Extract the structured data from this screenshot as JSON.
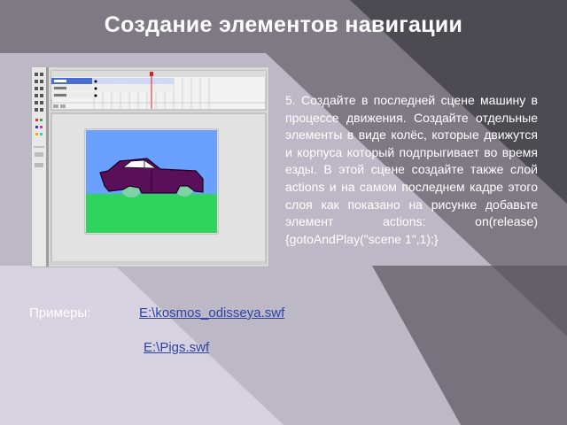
{
  "slide": {
    "title": "Создание элементов навигации",
    "body_text": "5. Создайте в последней сцене машину в процессе движения. Создайте отдельные элементы в виде колёс, которые движутся и корпуса который подпрыгивает во время езды. В этой сцене создайте также слой actions и на самом последнем кадре этого слоя как показано на  рисунке добавьте элемент actions: on(release){gotoAndPlay(\"scene 1\",1);}",
    "examples_label": "Примеры:",
    "links": [
      "E:\\kosmos_odisseya.swf",
      "E:\\Pigs.swf"
    ]
  },
  "colors": {
    "background_dark": "#4d4b52",
    "background_light": "#c9c4d3",
    "link": "#2d43a8",
    "stage_sky": "#6aa0ff",
    "stage_grass": "#2fd45c",
    "car_body": "#5a0f5a"
  }
}
